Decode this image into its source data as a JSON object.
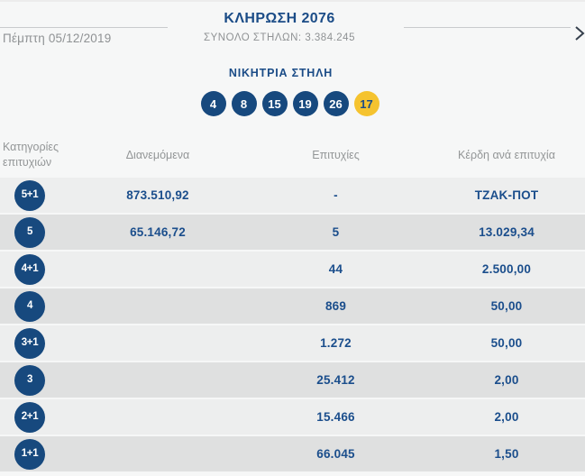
{
  "header": {
    "date": "Πέμπτη 05/12/2019",
    "title": "ΚΛΗΡΩΣΗ 2076",
    "subtitle": "ΣΥΝΟΛΟ ΣΤΗΛΩΝ: 3.384.245"
  },
  "winning": {
    "label": "ΝΙΚΗΤΡΙΑ ΣΤΗΛΗ",
    "numbers": [
      "4",
      "8",
      "15",
      "19",
      "26"
    ],
    "joker": "17"
  },
  "table": {
    "columns": {
      "category": "Κατηγορίες επιτυχιών",
      "distributed": "Διανεμόμενα",
      "winners": "Επιτυχίες",
      "prize": "Κέρδη ανά επιτυχία"
    },
    "rows": [
      {
        "category": "5+1",
        "distributed": "873.510,92",
        "winners": "-",
        "prize": "ΤΖΑΚ-ΠΟΤ"
      },
      {
        "category": "5",
        "distributed": "65.146,72",
        "winners": "5",
        "prize": "13.029,34"
      },
      {
        "category": "4+1",
        "distributed": "",
        "winners": "44",
        "prize": "2.500,00"
      },
      {
        "category": "4",
        "distributed": "",
        "winners": "869",
        "prize": "50,00"
      },
      {
        "category": "3+1",
        "distributed": "",
        "winners": "1.272",
        "prize": "50,00"
      },
      {
        "category": "3",
        "distributed": "",
        "winners": "25.412",
        "prize": "2,00"
      },
      {
        "category": "2+1",
        "distributed": "",
        "winners": "15.466",
        "prize": "2,00"
      },
      {
        "category": "1+1",
        "distributed": "",
        "winners": "66.045",
        "prize": "1,50"
      }
    ]
  },
  "colors": {
    "navy": "#17497E",
    "navy_text": "#1B4E8C",
    "joker_yellow": "#F5C32F",
    "row_light": "#EDEEEE",
    "row_dark": "#DFE0E0",
    "muted_text": "#8F9294"
  }
}
